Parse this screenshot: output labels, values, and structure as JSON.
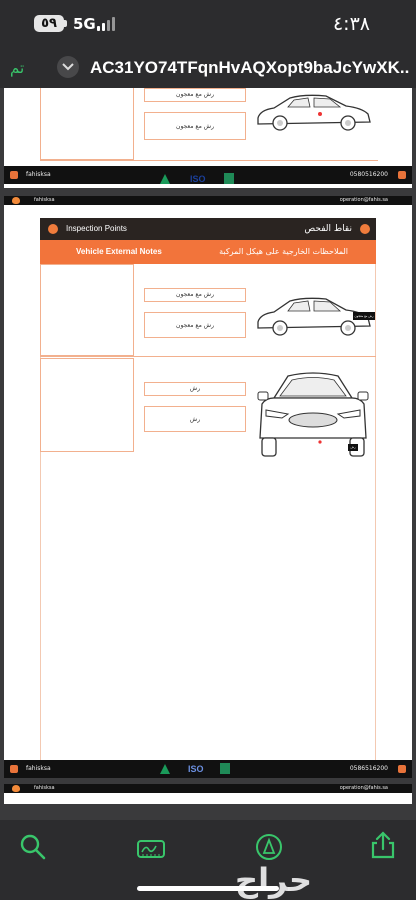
{
  "status": {
    "battery": "٥٩",
    "network": "5G",
    "time": "٤:٣٨"
  },
  "titlebar": {
    "done_label": "تم",
    "doc_title": "AC31YO74TFqnHvAQXopt9baJcYwXK..."
  },
  "page1": {
    "labels": [
      "رش مع معجون",
      "رش مع معجون"
    ],
    "footer": {
      "left": "fahisksa",
      "right": "0580516200"
    }
  },
  "page2": {
    "topbar": {
      "left": "fahisksa",
      "right": "operation@fahis.sa"
    },
    "header": {
      "en": "Inspection Points",
      "ar": "نقاط الفحص"
    },
    "subheader": {
      "en": "Vehicle External Notes",
      "ar": "الملاحظات الخارجية على هيكل المركبة"
    },
    "row1_labels": [
      "رش مع معجون",
      "رش مع معجون"
    ],
    "row2_labels": [
      "رش",
      "رش"
    ],
    "car_tag1": "رش مع معجون",
    "car_tag2": "رش",
    "footer": {
      "left": "fahisksa",
      "right": "0586516200"
    }
  },
  "page3": {
    "topbar": {
      "left": "fahisksa",
      "right": "operation@fahis.sa"
    }
  },
  "logos": {
    "iso": "ISO"
  },
  "watermark": "حراج",
  "colors": {
    "accent_green": "#39c66b",
    "brand_orange": "#f2743b",
    "header_dark": "#2a2421"
  },
  "icons": [
    "search-icon",
    "signature-icon",
    "markup-icon",
    "share-icon"
  ]
}
